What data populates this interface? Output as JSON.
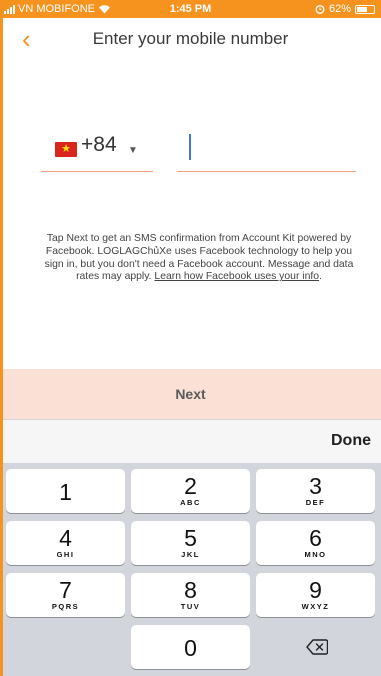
{
  "status_bar": {
    "carrier": "VN MOBIFONE",
    "time": "1:45 PM",
    "battery_percent": "62%",
    "battery_level": 0.62
  },
  "nav": {
    "back_icon": "chevron-left",
    "title": "Enter your mobile number"
  },
  "phone": {
    "country_code": "+84",
    "country_flag": "vietnam-flag",
    "number_value": ""
  },
  "disclaimer": {
    "text": "Tap Next to get an SMS confirmation from Account Kit powered by Facebook. LOGLAGChủXe uses Facebook technology to help you sign in, but you don't need a Facebook account. Message and data rates may apply.",
    "link": "Learn how Facebook uses your info",
    "link_suffix": "."
  },
  "next_label": "Next",
  "keyboard": {
    "done_label": "Done",
    "keys": [
      {
        "num": "1",
        "letters": ""
      },
      {
        "num": "2",
        "letters": "ABC"
      },
      {
        "num": "3",
        "letters": "DEF"
      },
      {
        "num": "4",
        "letters": "GHI"
      },
      {
        "num": "5",
        "letters": "JKL"
      },
      {
        "num": "6",
        "letters": "MNO"
      },
      {
        "num": "7",
        "letters": "PQRS"
      },
      {
        "num": "8",
        "letters": "TUV"
      },
      {
        "num": "9",
        "letters": "WXYZ"
      },
      {
        "num": "0",
        "letters": ""
      }
    ],
    "delete_icon": "backspace-icon"
  },
  "colors": {
    "accent": "#f6921e",
    "next_bg": "#fbe0d6",
    "keyboard_bg": "#d2d5db"
  }
}
